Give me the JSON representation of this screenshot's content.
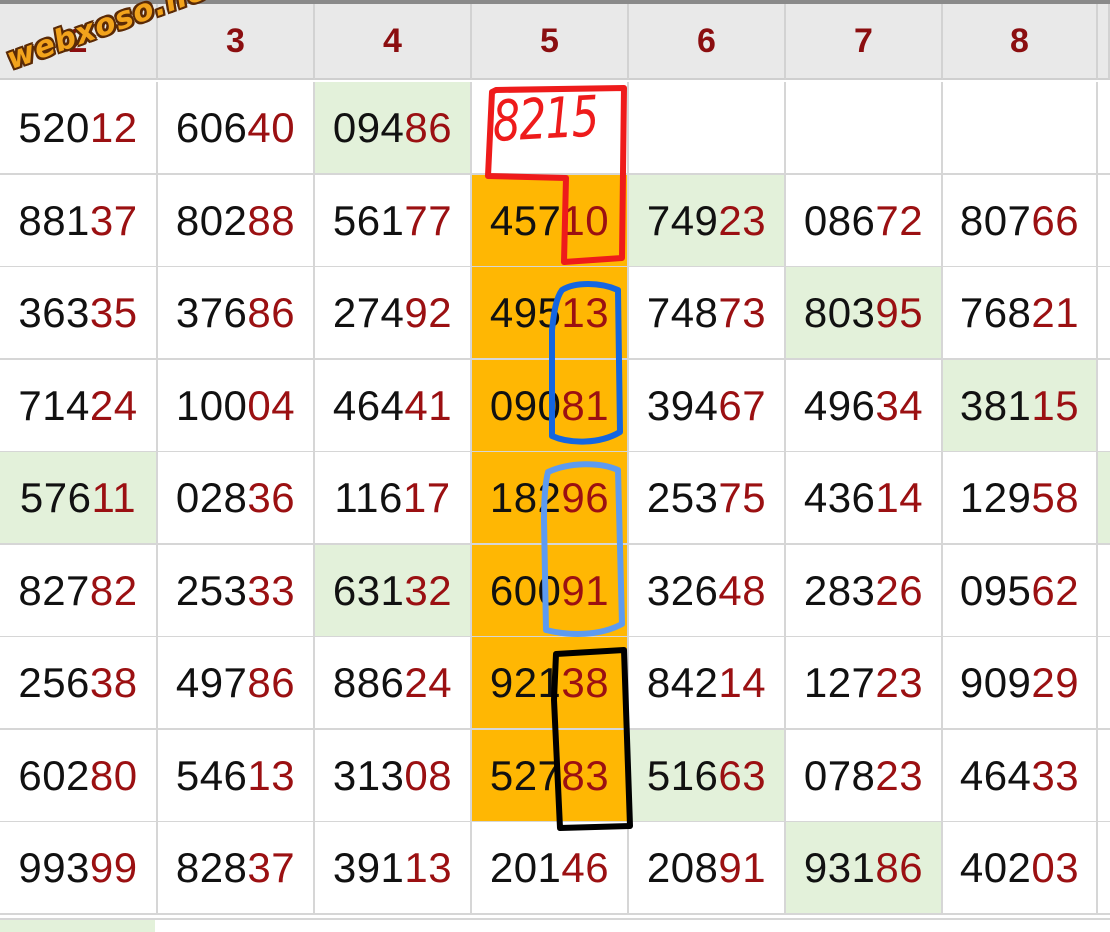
{
  "watermark": "webxoso.net",
  "handwritten_note": "8215",
  "headers": [
    "2",
    "3",
    "4",
    "5",
    "6",
    "7",
    "8"
  ],
  "rows": [
    [
      {
        "head": "520",
        "tail": "12"
      },
      {
        "head": "606",
        "tail": "40"
      },
      {
        "head": "094",
        "tail": "86",
        "hl": true
      },
      {
        "head": "",
        "tail": ""
      },
      {
        "head": "",
        "tail": ""
      },
      {
        "head": "",
        "tail": ""
      },
      {
        "head": "",
        "tail": ""
      }
    ],
    [
      {
        "head": "881",
        "tail": "37"
      },
      {
        "head": "802",
        "tail": "88"
      },
      {
        "head": "561",
        "tail": "77"
      },
      {
        "head": "457",
        "tail": "10",
        "sel": true
      },
      {
        "head": "749",
        "tail": "23",
        "hl": true
      },
      {
        "head": "086",
        "tail": "72"
      },
      {
        "head": "807",
        "tail": "66"
      }
    ],
    [
      {
        "head": "363",
        "tail": "35"
      },
      {
        "head": "376",
        "tail": "86"
      },
      {
        "head": "274",
        "tail": "92"
      },
      {
        "head": "495",
        "tail": "13",
        "sel": true
      },
      {
        "head": "748",
        "tail": "73"
      },
      {
        "head": "803",
        "tail": "95",
        "hl": true
      },
      {
        "head": "768",
        "tail": "21"
      }
    ],
    [
      {
        "head": "714",
        "tail": "24"
      },
      {
        "head": "100",
        "tail": "04"
      },
      {
        "head": "464",
        "tail": "41"
      },
      {
        "head": "090",
        "tail": "81",
        "sel": true
      },
      {
        "head": "394",
        "tail": "67"
      },
      {
        "head": "496",
        "tail": "34"
      },
      {
        "head": "381",
        "tail": "15",
        "hl": true
      }
    ],
    [
      {
        "head": "576",
        "tail": "11",
        "hl": true
      },
      {
        "head": "028",
        "tail": "36"
      },
      {
        "head": "116",
        "tail": "17"
      },
      {
        "head": "182",
        "tail": "96",
        "sel": true
      },
      {
        "head": "253",
        "tail": "75"
      },
      {
        "head": "436",
        "tail": "14"
      },
      {
        "head": "129",
        "tail": "58"
      }
    ],
    [
      {
        "head": "827",
        "tail": "82"
      },
      {
        "head": "253",
        "tail": "33"
      },
      {
        "head": "631",
        "tail": "32",
        "hl": true
      },
      {
        "head": "600",
        "tail": "91",
        "sel": true
      },
      {
        "head": "326",
        "tail": "48"
      },
      {
        "head": "283",
        "tail": "26"
      },
      {
        "head": "095",
        "tail": "62"
      }
    ],
    [
      {
        "head": "256",
        "tail": "38"
      },
      {
        "head": "497",
        "tail": "86"
      },
      {
        "head": "886",
        "tail": "24"
      },
      {
        "head": "921",
        "tail": "38",
        "sel": true
      },
      {
        "head": "842",
        "tail": "14"
      },
      {
        "head": "127",
        "tail": "23"
      },
      {
        "head": "909",
        "tail": "29"
      }
    ],
    [
      {
        "head": "602",
        "tail": "80"
      },
      {
        "head": "546",
        "tail": "13"
      },
      {
        "head": "313",
        "tail": "08"
      },
      {
        "head": "527",
        "tail": "83",
        "sel": true
      },
      {
        "head": "516",
        "tail": "63",
        "hl": true
      },
      {
        "head": "078",
        "tail": "23"
      },
      {
        "head": "464",
        "tail": "33"
      }
    ],
    [
      {
        "head": "993",
        "tail": "99"
      },
      {
        "head": "828",
        "tail": "37"
      },
      {
        "head": "391",
        "tail": "13"
      },
      {
        "head": "201",
        "tail": "46"
      },
      {
        "head": "208",
        "tail": "91"
      },
      {
        "head": "931",
        "tail": "86",
        "hl": true
      },
      {
        "head": "402",
        "tail": "03"
      }
    ]
  ],
  "colors": {
    "header_text": "#8b0e10",
    "digit_text": "#111111",
    "tail_text": "#9b1012",
    "highlight_green": "#e3f1da",
    "selected_column": "#ffb703",
    "annotation_red": "#ee1b1b",
    "annotation_blue": "#1466e0",
    "annotation_light_blue": "#5d9bf0",
    "annotation_black": "#000000"
  }
}
